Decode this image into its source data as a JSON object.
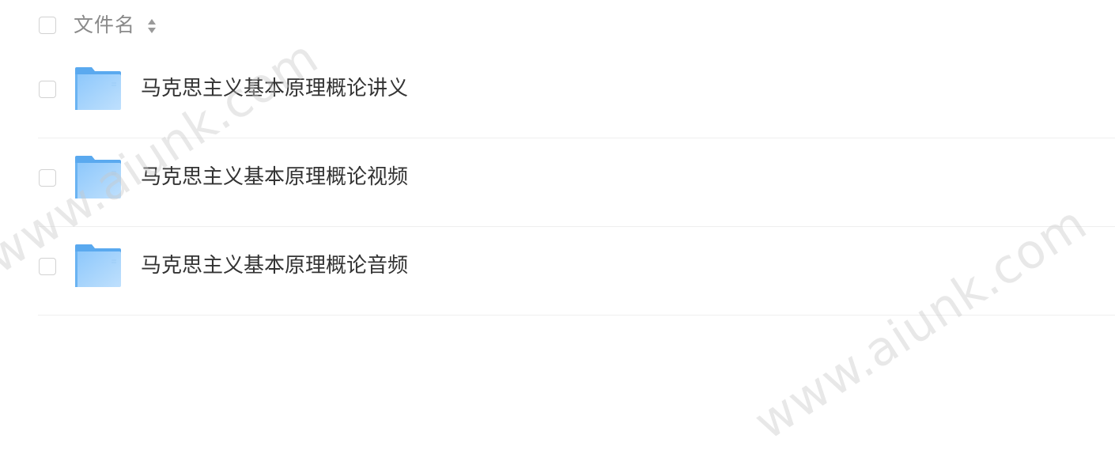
{
  "header": {
    "column_label": "文件名",
    "sort_icon": "sort-updown-icon"
  },
  "files": [
    {
      "name": "马克思主义基本原理概论讲义",
      "type": "folder",
      "icon": "folder-icon"
    },
    {
      "name": "马克思主义基本原理概论视频",
      "type": "folder",
      "icon": "folder-icon"
    },
    {
      "name": "马克思主义基本原理概论音频",
      "type": "folder",
      "icon": "folder-icon"
    }
  ],
  "watermark": {
    "text": "www.aiunk.com"
  },
  "colors": {
    "folder": "#6ab3f2",
    "folder_light": "#a6d4fb",
    "text": "#333333",
    "header_text": "#8a8a8a",
    "divider": "#efefef",
    "checkbox_border": "#d2d2d2"
  }
}
